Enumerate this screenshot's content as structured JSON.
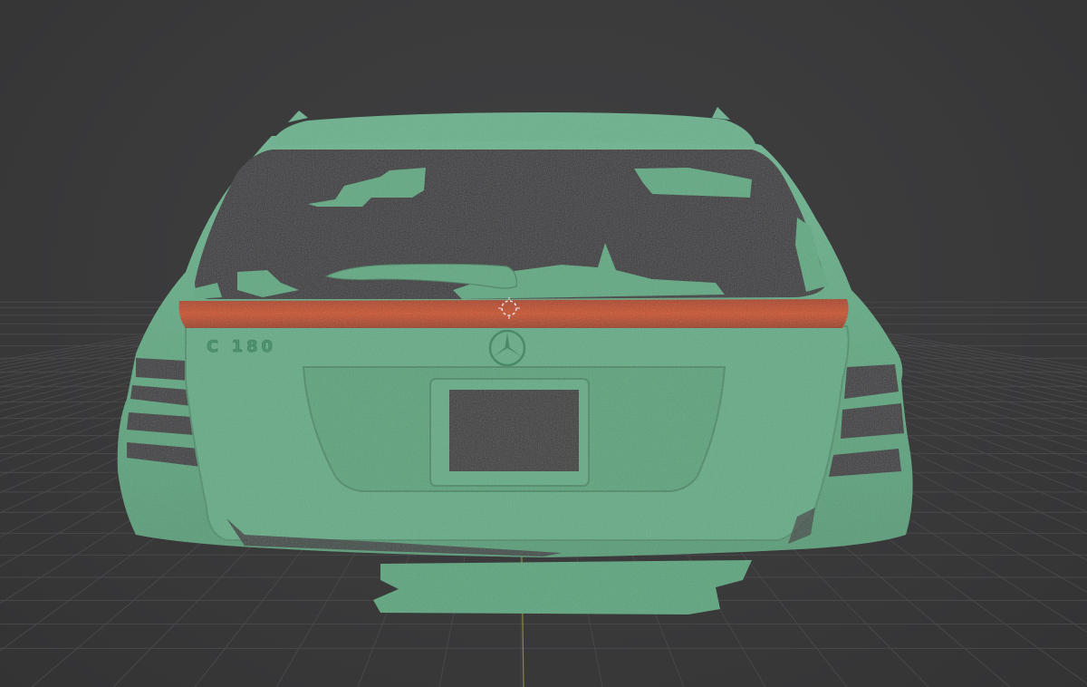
{
  "viewport": {
    "background": "#3a3a3b",
    "grid_color": "#4a4a4c",
    "y_axis_color": "#9aa03c"
  },
  "model": {
    "mesh_color": "#5fa882",
    "mesh_dark": "#3f7a5b",
    "mesh_light": "#7cc09c",
    "selection_color": "#c8501c",
    "badge_text": "C 180"
  },
  "icons": {
    "pivot": "3d-cursor-icon",
    "emblem": "mercedes-star-icon"
  }
}
